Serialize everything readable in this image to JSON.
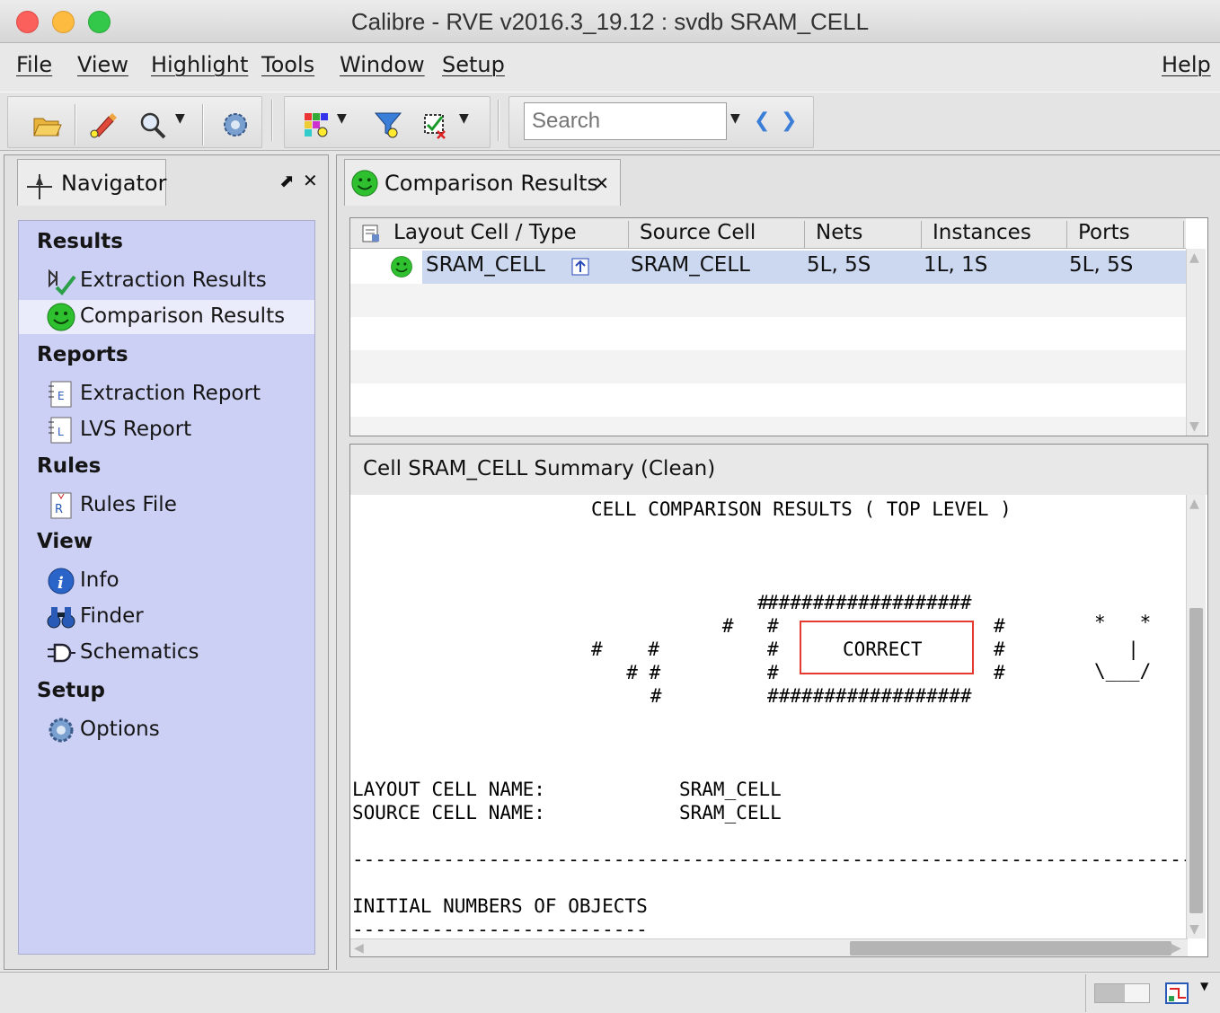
{
  "window": {
    "title": "Calibre - RVE v2016.3_19.12 : svdb SRAM_CELL"
  },
  "menubar": {
    "items": [
      "File",
      "View",
      "Highlight",
      "Tools",
      "Window",
      "Setup"
    ],
    "help": "Help"
  },
  "toolbar": {
    "search_placeholder": "Search",
    "icons": [
      "open-folder-icon",
      "highlight-pen-icon",
      "zoom-icon",
      "gear-icon",
      "color-palette-icon",
      "filter-icon",
      "check-cell-icon",
      "nav-back-icon",
      "nav-forward-icon"
    ]
  },
  "navigator": {
    "tab_label": "Navigator",
    "float_symbol": "⬈",
    "close_symbol": "✕",
    "sections": [
      {
        "title": "Results",
        "items": [
          "Extraction Results",
          "Comparison Results"
        ]
      },
      {
        "title": "Reports",
        "items": [
          "Extraction Report",
          "LVS Report"
        ]
      },
      {
        "title": "Rules",
        "items": [
          "Rules File"
        ]
      },
      {
        "title": "View",
        "items": [
          "Info",
          "Finder",
          "Schematics"
        ]
      },
      {
        "title": "Setup",
        "items": [
          "Options"
        ]
      }
    ],
    "selected": "Comparison Results"
  },
  "comparison_tab": {
    "label": "Comparison Results",
    "close_symbol": "✕"
  },
  "results_table": {
    "columns": [
      "Layout Cell / Type",
      "Source Cell",
      "Nets",
      "Instances",
      "Ports"
    ],
    "rows": [
      {
        "layout_cell": "SRAM_CELL",
        "source_cell": "SRAM_CELL",
        "nets": "5L, 5S",
        "instances": "1L, 1S",
        "ports": "5L, 5S",
        "status": "correct"
      }
    ]
  },
  "summary": {
    "header": "Cell SRAM_CELL Summary (Clean)",
    "heading": "CELL COMPARISON RESULTS ( TOP LEVEL )",
    "check_art": [
      "        #",
      "      #",
      "#    #",
      "  # #",
      "   #"
    ],
    "box_top": "##################",
    "box_side": "#",
    "result": "CORRECT",
    "face_art": [
      "*   *",
      "  |",
      "\\___/"
    ],
    "layout_cell_label": "LAYOUT CELL NAME:",
    "layout_cell_value": "SRAM_CELL",
    "source_cell_label": "SOURCE CELL NAME:",
    "source_cell_value": "SRAM_CELL",
    "divider": "-----------------------------------------------------------------------------------------------------------------",
    "objects_heading": "INITIAL NUMBERS OF OBJECTS",
    "objects_underline": "--------------------------"
  },
  "status": {
    "memory_usage": 0.55
  },
  "colors": {
    "accent": "#e53a2f",
    "nav_bg": "#ccd0f4",
    "selection": "#ccd8f0"
  }
}
